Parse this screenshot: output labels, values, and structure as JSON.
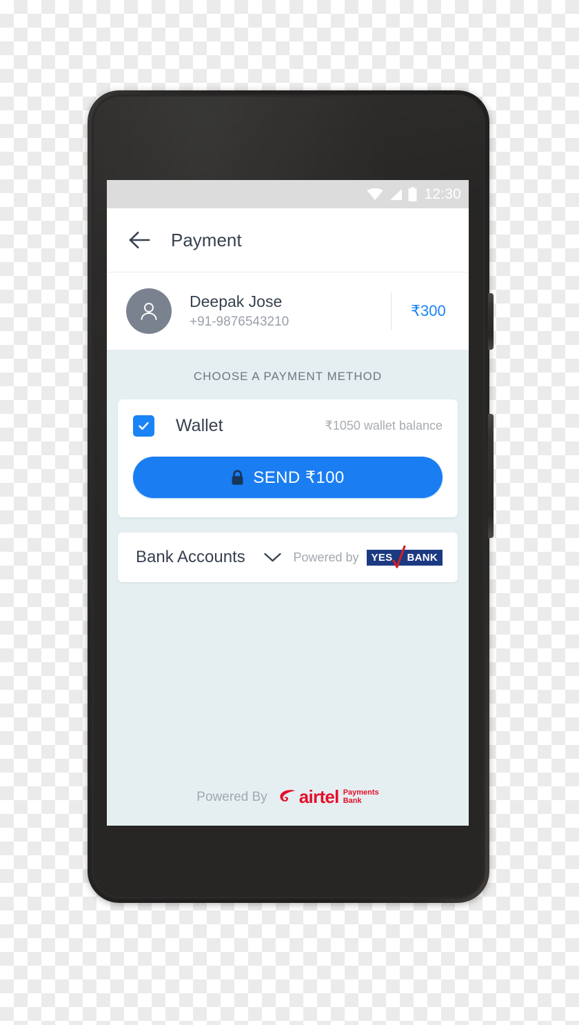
{
  "device": {
    "name": "smartphone-mockup",
    "camera_icon": "front-camera",
    "speaker_icon": "earpiece-speaker",
    "sensor_icon": "proximity-sensor",
    "power_button": "power-button",
    "volume_button": "volume-rocker"
  },
  "status_bar": {
    "wifi_icon": "wifi-icon",
    "signal_icon": "cellular-signal-icon",
    "battery_icon": "battery-icon",
    "time": "12:30",
    "background": "#dcdcdc",
    "icon_color": "#ffffff"
  },
  "app_bar": {
    "back_icon": "back-arrow-icon",
    "title": "Payment"
  },
  "payee": {
    "avatar_icon": "person-avatar-icon",
    "name": "Deepak Jose",
    "phone": "+91-9876543210",
    "amount": "₹300",
    "amount_color": "#1a83f5"
  },
  "payment_section": {
    "heading": "CHOOSE A PAYMENT METHOD",
    "wallet": {
      "checkbox_icon": "checkbox-checked-icon",
      "checked": true,
      "label": "Wallet",
      "balance": "₹1050 wallet balance",
      "accent_color": "#1a83f5"
    },
    "send_button": {
      "lock_icon": "lock-icon",
      "label": "SEND ₹100",
      "background": "#1a7df2",
      "text_color": "#ffffff"
    }
  },
  "bank_accounts": {
    "title": "Bank Accounts",
    "chevron_icon": "chevron-down-icon",
    "powered_by_label": "Powered by",
    "bank_logo": {
      "name": "yes-bank-logo",
      "yes_text": "YES",
      "bank_text": "BANK",
      "background": "#1b3a82",
      "slash_color": "#cc2027"
    }
  },
  "footer": {
    "powered_by_label": "Powered By",
    "brand_icon": "airtel-swirl-icon",
    "brand_name": "airtel",
    "brand_sub_line1": "Payments",
    "brand_sub_line2": "Bank",
    "brand_color": "#e40f2b"
  },
  "theme": {
    "screen_background": "#e5eff1",
    "card_background": "#ffffff",
    "text_primary": "#37404f",
    "text_secondary": "#a2a8ae"
  }
}
